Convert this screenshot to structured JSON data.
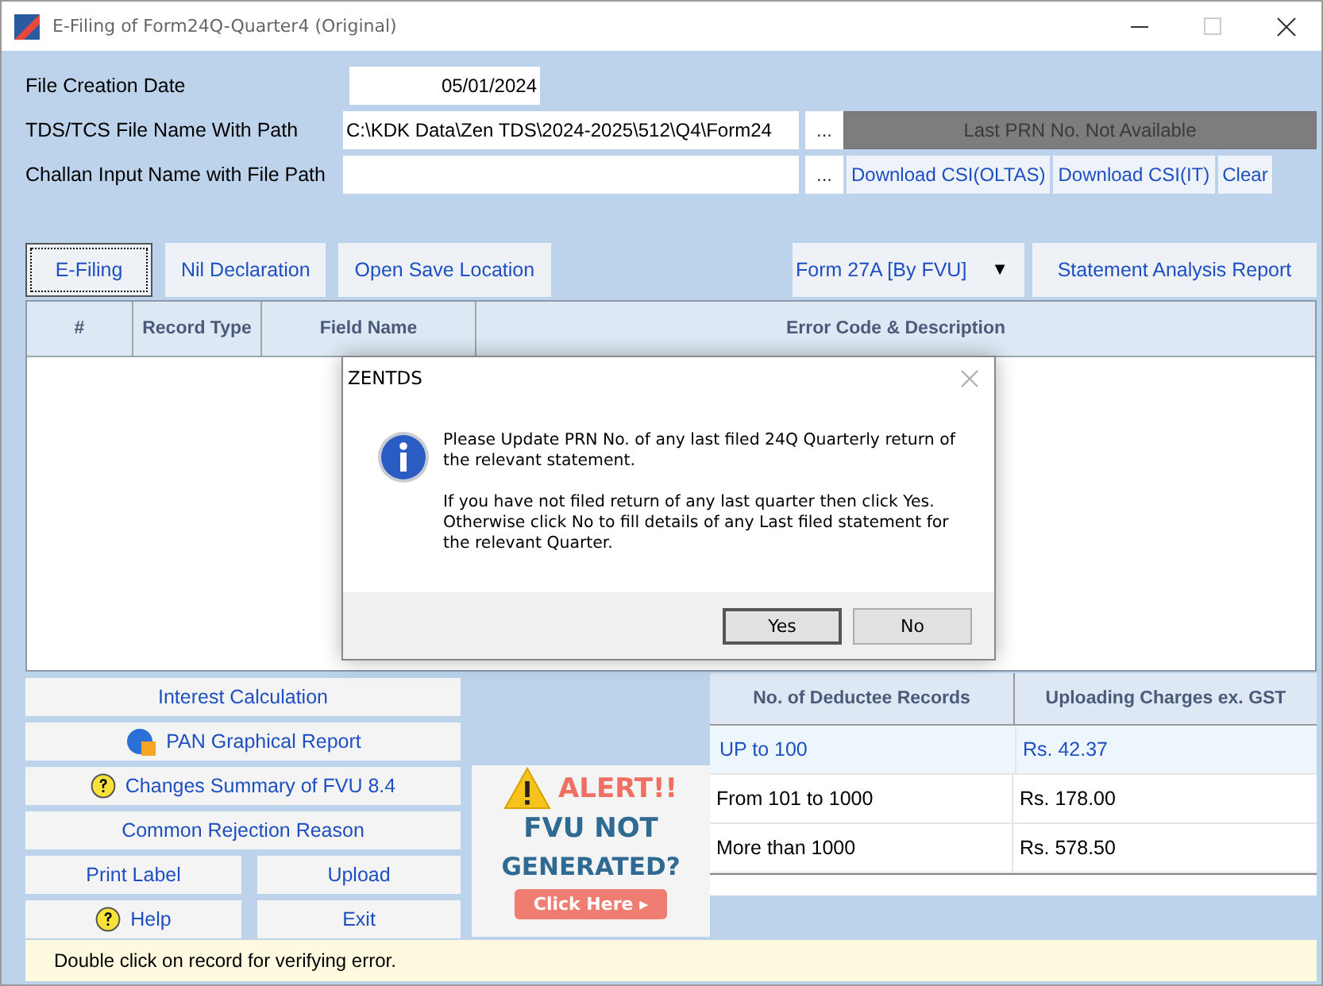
{
  "window": {
    "title": "E-Filing of Form24Q-Quarter4 (Original)"
  },
  "form": {
    "fields": [
      {
        "label": "File Creation Date",
        "value": "05/01/2024",
        "kind": "date"
      },
      {
        "label": "TDS/TCS File Name With Path",
        "value": "C:\\KDK Data\\Zen TDS\\2024-2025\\512\\Q4\\Form24",
        "kind": "path",
        "browse": "...",
        "prn": {
          "text": "Last PRN No. Not Available",
          "disabled": true
        }
      },
      {
        "label": "Challan Input Name with File Path",
        "kind": "path",
        "browse": "...",
        "buttons": [
          "Download CSI(OLTAS)",
          "Download CSI(IT)",
          "Clear"
        ]
      }
    ]
  },
  "actions": [
    {
      "label": "E-Filing",
      "focused": true
    },
    {
      "label": "Nil Declaration",
      "focused": false
    },
    {
      "label": "Open Save Location",
      "focused": false
    }
  ],
  "form_select": {
    "value": "Form 27A [By FVU]",
    "arrow": "▼"
  },
  "report_button": "Statement Analysis Report",
  "error_grid": {
    "columns": [
      "#",
      "Record Type",
      "Field Name",
      "Error Code & Description"
    ]
  },
  "tools": [
    {
      "label": "Interest Calculation",
      "kind": "plain"
    },
    {
      "label": "PAN Graphical Report",
      "kind": "pie"
    },
    {
      "label": "Changes Summary of FVU 8.4",
      "kind": "help"
    },
    {
      "label": "Common Rejection Reason",
      "kind": "plain"
    },
    {
      "label": "Print Label",
      "kind": "plain"
    },
    {
      "label": "Upload",
      "kind": "plain"
    },
    {
      "label": "Help",
      "kind": "help"
    },
    {
      "label": "Exit",
      "kind": "plain"
    }
  ],
  "alert_banner": {
    "heading": "ALERT!!",
    "line1": "FVU NOT",
    "line2": "GENERATED?",
    "button": "Click Here ▸"
  },
  "charges": {
    "columns": [
      "No. of Deductee Records",
      "Uploading Charges ex. GST"
    ],
    "rows": [
      {
        "records": "UP to 100",
        "charge": "Rs. 42.37",
        "selected": true
      },
      {
        "records": "From 101 to 1000",
        "charge": "Rs. 178.00",
        "selected": false
      },
      {
        "records": "More than 1000",
        "charge": "Rs. 578.50",
        "selected": false
      }
    ]
  },
  "status_bar": "Double click on record for verifying error.",
  "dialog": {
    "title": "ZENTDS",
    "paragraphs": [
      "Please Update PRN No. of any last filed 24Q Quarterly return of the relevant statement.",
      "If you have not filed return of any last quarter then click Yes. Otherwise click No to fill details of any Last filed statement for the relevant Quarter."
    ],
    "buttons": [
      {
        "label": "Yes",
        "default": true
      },
      {
        "label": "No",
        "default": false
      }
    ]
  }
}
